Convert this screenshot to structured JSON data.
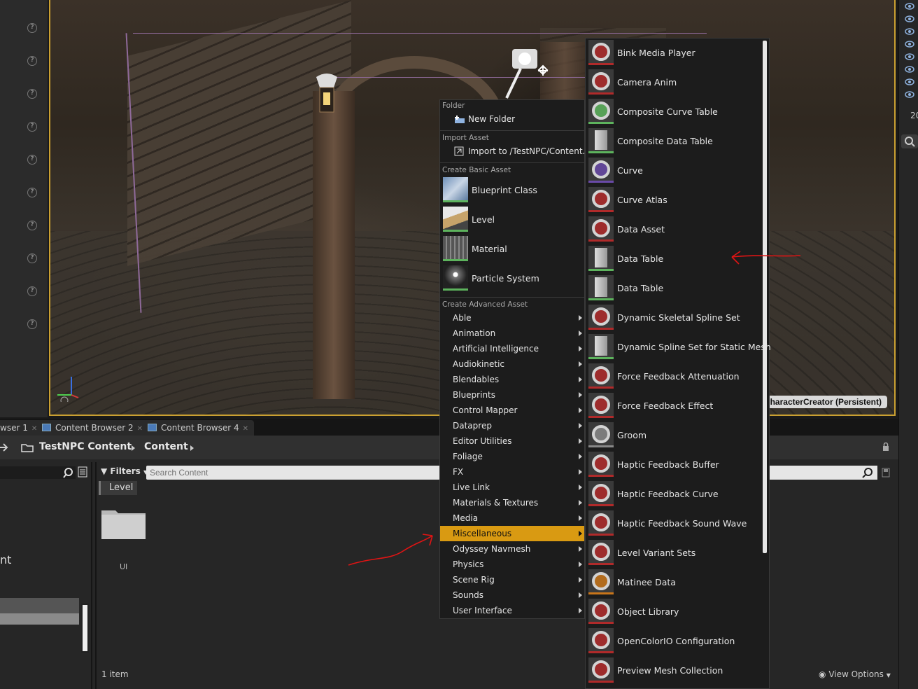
{
  "viewport": {
    "level_badge": "CharacterCreator (Persistent)"
  },
  "right_strip": {
    "number": "20"
  },
  "tabs": [
    {
      "label": "wser 1"
    },
    {
      "label": "Content Browser 2"
    },
    {
      "label": "Content Browser 4"
    }
  ],
  "path": {
    "root": "TestNPC Content",
    "folder": "Content"
  },
  "filters_label": "Filters",
  "search_placeholder": "Search Content",
  "filter_chip": "Level",
  "left_pane_text": "nt",
  "folder_item": {
    "label": "UI"
  },
  "status": {
    "item_count": "1 item",
    "view_options": "View Options"
  },
  "context_menu": {
    "folder_header": "Folder",
    "new_folder": "New Folder",
    "import_header": "Import Asset",
    "import_item": "Import to /TestNPC/Content...",
    "basic_header": "Create Basic Asset",
    "basic_items": [
      {
        "label": "Blueprint Class",
        "icon": "blueprint-class-icon"
      },
      {
        "label": "Level",
        "icon": "level-icon"
      },
      {
        "label": "Material",
        "icon": "material-icon"
      },
      {
        "label": "Particle System",
        "icon": "particle-system-icon"
      }
    ],
    "advanced_header": "Create Advanced Asset",
    "advanced_items": [
      "Able",
      "Animation",
      "Artificial Intelligence",
      "Audiokinetic",
      "Blendables",
      "Blueprints",
      "Control Mapper",
      "Dataprep",
      "Editor Utilities",
      "Foliage",
      "FX",
      "Live Link",
      "Materials & Textures",
      "Media",
      "Miscellaneous",
      "Odyssey Navmesh",
      "Physics",
      "Scene Rig",
      "Sounds",
      "User Interface"
    ],
    "highlighted": "Miscellaneous",
    "highlight_color": "#d99a12"
  },
  "submenu": {
    "items": [
      {
        "label": "Bink Media Player",
        "icon": "bink-media-player-icon",
        "accent": "#b02a2a"
      },
      {
        "label": "Camera Anim",
        "icon": "camera-anim-icon",
        "accent": "#b02a2a"
      },
      {
        "label": "Composite Curve Table",
        "icon": "composite-curve-table-icon",
        "accent": "#5db35d"
      },
      {
        "label": "Composite Data Table",
        "icon": "composite-data-table-icon",
        "accent": "#5db35d"
      },
      {
        "label": "Curve",
        "icon": "curve-icon",
        "accent": "#6a4aa8"
      },
      {
        "label": "Curve Atlas",
        "icon": "curve-atlas-icon",
        "accent": "#b02a2a"
      },
      {
        "label": "Data Asset",
        "icon": "data-asset-icon",
        "accent": "#b02a2a"
      },
      {
        "label": "Data Table",
        "icon": "data-table-icon",
        "accent": "#5db35d"
      },
      {
        "label": "Data Table",
        "icon": "data-table-icon",
        "accent": "#5db35d"
      },
      {
        "label": "Dynamic Skeletal Spline Set",
        "icon": "dynamic-skeletal-spline-set-icon",
        "accent": "#b02a2a"
      },
      {
        "label": "Dynamic Spline Set for Static Mesh",
        "icon": "dynamic-spline-set-icon",
        "accent": "#5db35d"
      },
      {
        "label": "Force Feedback Attenuation",
        "icon": "force-feedback-attenuation-icon",
        "accent": "#b02a2a"
      },
      {
        "label": "Force Feedback Effect",
        "icon": "force-feedback-effect-icon",
        "accent": "#b02a2a"
      },
      {
        "label": "Groom",
        "icon": "groom-icon",
        "accent": "#888888"
      },
      {
        "label": "Haptic Feedback Buffer",
        "icon": "haptic-feedback-buffer-icon",
        "accent": "#b02a2a"
      },
      {
        "label": "Haptic Feedback Curve",
        "icon": "haptic-feedback-curve-icon",
        "accent": "#b02a2a"
      },
      {
        "label": "Haptic Feedback Sound Wave",
        "icon": "haptic-feedback-sound-wave-icon",
        "accent": "#b02a2a"
      },
      {
        "label": "Level Variant Sets",
        "icon": "level-variant-sets-icon",
        "accent": "#b02a2a"
      },
      {
        "label": "Matinee Data",
        "icon": "matinee-data-icon",
        "accent": "#c8751a"
      },
      {
        "label": "Object Library",
        "icon": "object-library-icon",
        "accent": "#b02a2a"
      },
      {
        "label": "OpenColorIO Configuration",
        "icon": "opencolorio-configuration-icon",
        "accent": "#b02a2a"
      },
      {
        "label": "Preview Mesh Collection",
        "icon": "preview-mesh-collection-icon",
        "accent": "#b02a2a"
      }
    ]
  }
}
